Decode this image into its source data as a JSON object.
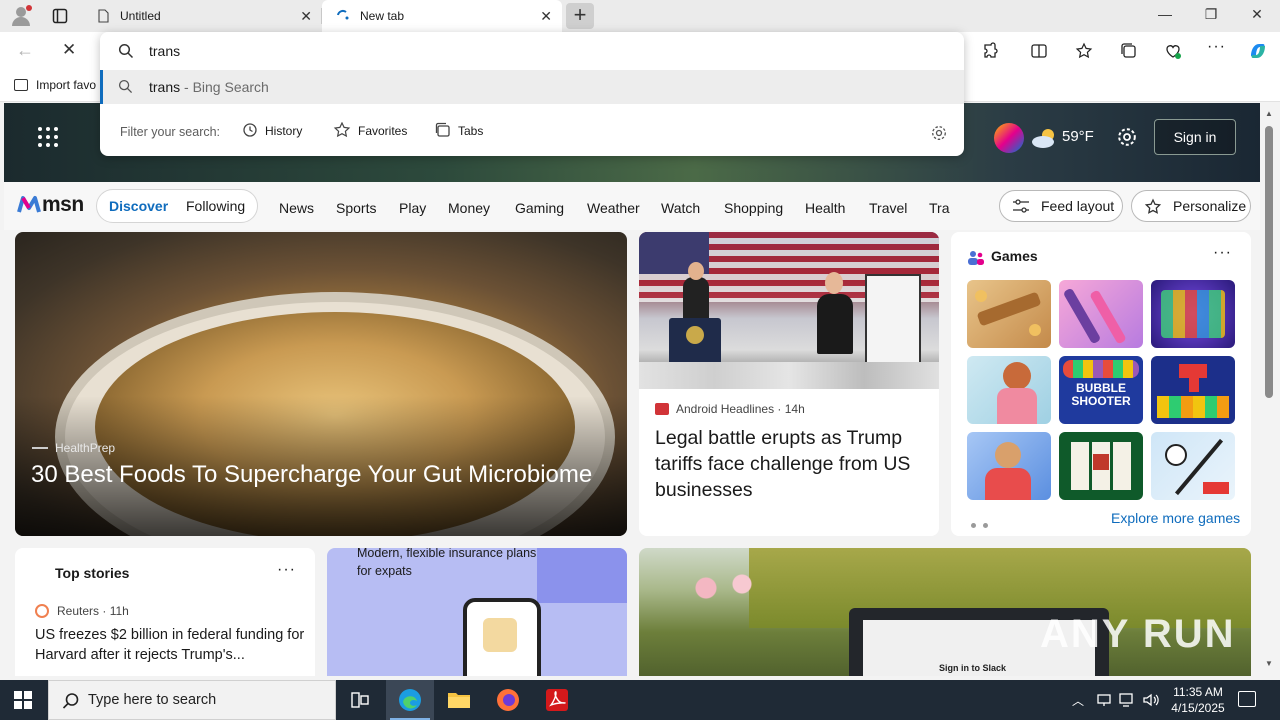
{
  "browser": {
    "tabs": [
      {
        "title": "Untitled",
        "active": false
      },
      {
        "title": "New tab",
        "active": true
      }
    ],
    "bookmarks_bar": {
      "import_label": "Import favo"
    }
  },
  "omnibox": {
    "value": "trans",
    "suggestion": {
      "query": "trans",
      "suffix": " - Bing Search"
    },
    "filter_label": "Filter your search:",
    "filters": [
      "History",
      "Favorites",
      "Tabs"
    ]
  },
  "msn": {
    "logo": "msn",
    "weather": {
      "temp": "59°F"
    },
    "signin_label": "Sign in",
    "pill": {
      "discover": "Discover",
      "following": "Following"
    },
    "nav": [
      "News",
      "Sports",
      "Play",
      "Money",
      "Gaming",
      "Weather",
      "Watch",
      "Shopping",
      "Health",
      "Travel",
      "Tra"
    ],
    "feed_layout_label": "Feed layout",
    "personalize_label": "Personalize",
    "hero_card": {
      "source": "HealthPrep",
      "headline": "30 Best Foods To Supercharge Your Gut Microbiome"
    },
    "news_card": {
      "source": "Android Headlines",
      "age": "14h",
      "headline": "Legal battle erupts as Trump tariffs face challenge from US businesses"
    },
    "games_card": {
      "title": "Games",
      "more": "···",
      "explore_label": "Explore more games",
      "bubble_tile": "BUBBLE SHOOTER"
    },
    "top_stories": {
      "title": "Top stories",
      "more": "···",
      "source": "Reuters",
      "age": "11h",
      "headline": "US freezes $2 billion in federal funding for Harvard after it rejects Trump's..."
    },
    "ad_card": {
      "text": "Modern, flexible insurance plans for expats"
    },
    "photo_card": {
      "screen_text": "Sign in to Slack"
    }
  },
  "watermark": "ANY RUN",
  "taskbar": {
    "search_placeholder": "Type here to search",
    "time": "11:35 AM",
    "date": "4/15/2025"
  },
  "colors": {
    "accent": "#0f6cbd",
    "taskbar": "#1f2a36",
    "tab_bar": "#ebebeb"
  }
}
